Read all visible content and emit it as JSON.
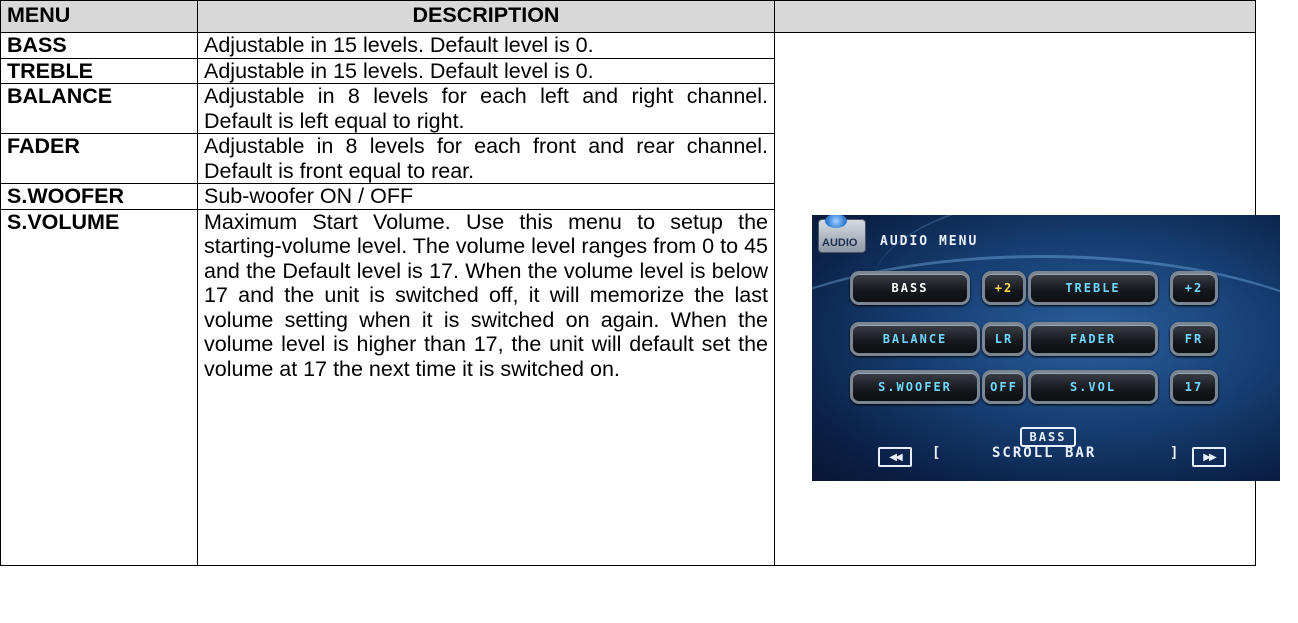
{
  "table": {
    "headers": [
      "MENU",
      "DESCRIPTION",
      ""
    ],
    "rows": [
      {
        "menu": "BASS",
        "description": "Adjustable in 15 levels. Default level is 0."
      },
      {
        "menu": "TREBLE",
        "description": "Adjustable in 15 levels. Default level is 0."
      },
      {
        "menu": "BALANCE",
        "description": "Adjustable in 8 levels for each left and right channel. Default is left equal to right."
      },
      {
        "menu": "FADER",
        "description": "Adjustable in 8 levels for each front and rear channel. Default is front equal to rear."
      },
      {
        "menu": "S.WOOFER",
        "description": "Sub-woofer ON / OFF"
      },
      {
        "menu": "S.VOLUME",
        "description": "Maximum Start Volume. Use this menu to setup the starting-volume level. The volume level ranges from 0 to 45 and the Default level is 17. When the volume level is below 17 and the unit is switched off, it will memorize the last volume setting when it is switched on again. When the volume level is higher than 17, the unit will default set the volume at 17 the next time it is switched on."
      }
    ]
  },
  "screen": {
    "icon_label": "AUDIO",
    "title": "AUDIO MENU",
    "buttons": {
      "bass": "BASS",
      "bass_val": "+2",
      "treble": "TREBLE",
      "treble_val": "+2",
      "balance": "BALANCE",
      "balance_val": "LR",
      "fader": "FADER",
      "fader_val": "FR",
      "swoofer": "S.WOOFER",
      "swoofer_val": "OFF",
      "svol": "S.VOL",
      "svol_val": "17"
    },
    "scroll": {
      "selected": "BASS",
      "label": "SCROLL BAR",
      "left_bracket": "[",
      "right_bracket": "]",
      "prev_icon": "rewind-icon",
      "next_icon": "fast-forward-icon"
    }
  }
}
